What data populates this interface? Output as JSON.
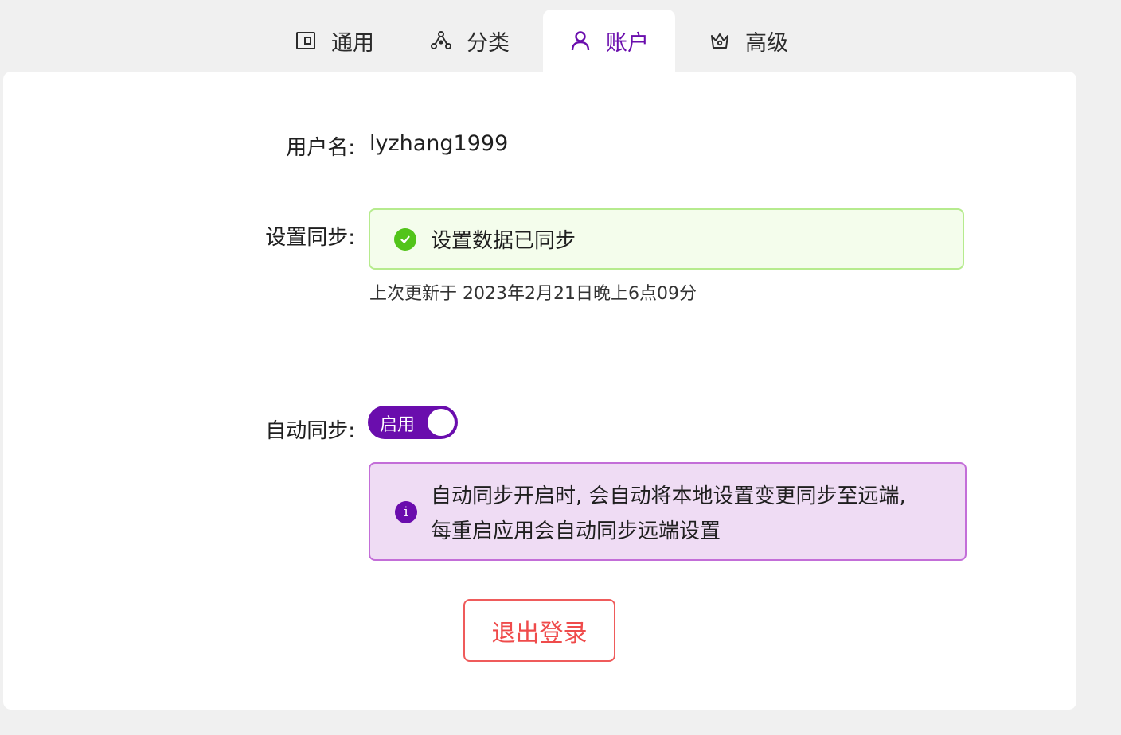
{
  "tabs": [
    {
      "label": "通用",
      "icon": "wallet-icon"
    },
    {
      "label": "分类",
      "icon": "nodes-icon"
    },
    {
      "label": "账户",
      "icon": "user-icon"
    },
    {
      "label": "高级",
      "icon": "crown-icon"
    }
  ],
  "active_tab": "账户",
  "account": {
    "username_label": "用户名:",
    "username": "lyzhang1999",
    "sync_label": "设置同步:",
    "sync_status": "设置数据已同步",
    "last_update": "上次更新于 2023年2月21日晚上6点09分",
    "auto_sync_label": "自动同步:",
    "auto_sync_toggle_label": "启用",
    "auto_sync_enabled": true,
    "auto_sync_info_line1": "自动同步开启时, 会自动将本地设置变更同步至远端,",
    "auto_sync_info_line2": "每重启应用会自动同步远端设置",
    "logout_label": "退出登录"
  },
  "colors": {
    "accent": "#6a0dad",
    "success": "#52c41a",
    "danger": "#ef4b4b",
    "info_bg": "#efdcf4",
    "success_bg": "#f4fdec"
  }
}
